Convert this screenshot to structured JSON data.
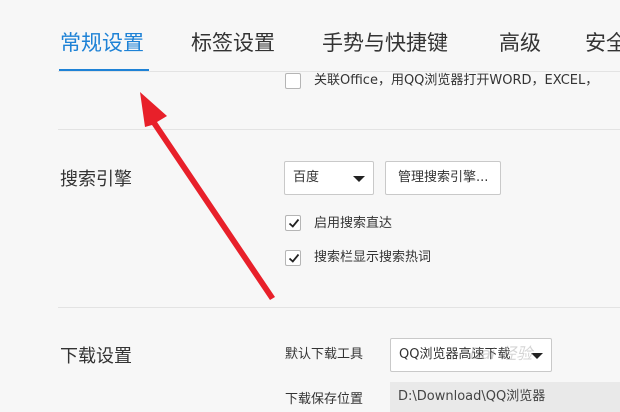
{
  "tabs": [
    {
      "label": "常规设置",
      "active": true
    },
    {
      "label": "标签设置",
      "active": false
    },
    {
      "label": "手势与快捷键",
      "active": false
    },
    {
      "label": "高级",
      "active": false
    },
    {
      "label": "安全",
      "active": false
    }
  ],
  "office_assoc": {
    "label": "关联Office，用QQ浏览器打开WORD，EXCEL，",
    "checked": false
  },
  "search_engine": {
    "title": "搜索引擎",
    "selected_engine": "百度",
    "manage_button": "管理搜索引擎...",
    "options": [
      {
        "label": "启用搜索直达",
        "checked": true
      },
      {
        "label": "搜索栏显示搜索热词",
        "checked": true
      }
    ]
  },
  "download": {
    "title": "下载设置",
    "default_tool_label": "默认下载工具",
    "default_tool_value": "QQ浏览器高速下载",
    "save_location_label": "下载保存位置",
    "save_location_value": "D:\\Download\\QQ浏览器"
  },
  "watermark": "Bai 经验",
  "colors": {
    "accent": "#1e82d6",
    "arrow": "#e8202a",
    "background": "#f7f7f7"
  }
}
